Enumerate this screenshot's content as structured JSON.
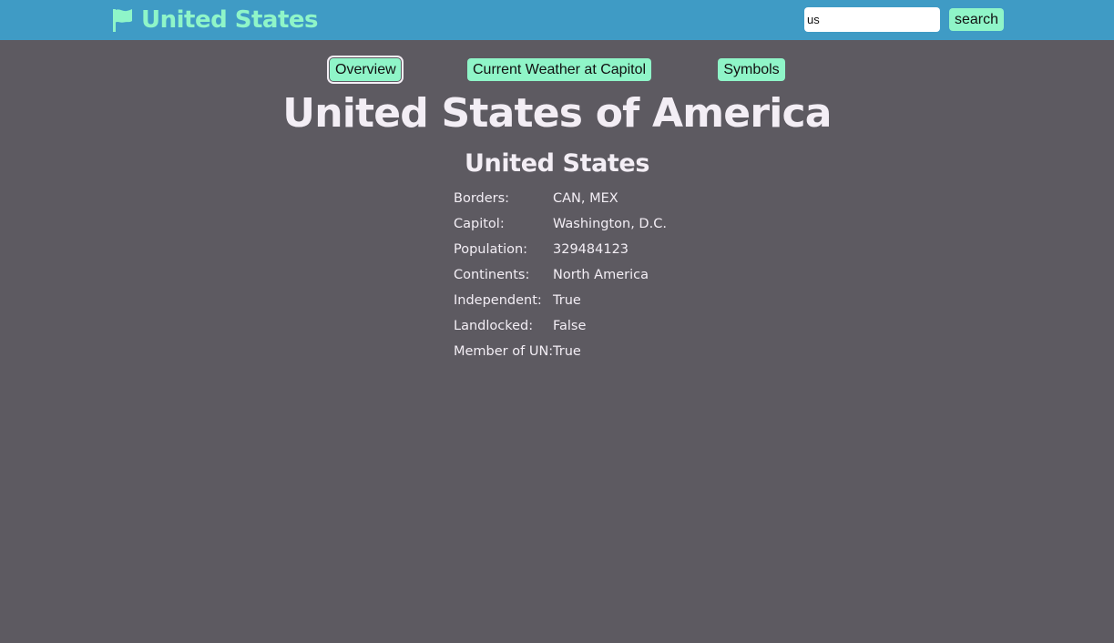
{
  "header": {
    "brand_title": "United States",
    "search": {
      "value": "us",
      "button_label": "search"
    }
  },
  "tabs": [
    {
      "label": "Overview",
      "active": true
    },
    {
      "label": "Current Weather at Capitol",
      "active": false
    },
    {
      "label": "Symbols",
      "active": false
    }
  ],
  "main": {
    "title": "United States of America",
    "subtitle": "United States",
    "facts": [
      {
        "label": "Borders:",
        "value": "CAN, MEX"
      },
      {
        "label": "Capitol:",
        "value": "Washington, D.C."
      },
      {
        "label": "Population:",
        "value": "329484123"
      },
      {
        "label": "Continents:",
        "value": "North America"
      },
      {
        "label": "Independent:",
        "value": "True"
      },
      {
        "label": "Landlocked:",
        "value": "False"
      },
      {
        "label": "Member of UN:",
        "value": "True"
      }
    ]
  },
  "colors": {
    "background": "#5d5a61",
    "header_bar": "#3f9bc5",
    "accent": "#8ff5c8",
    "text": "#f3eef5"
  },
  "icons": {
    "brand": "flag-icon"
  }
}
